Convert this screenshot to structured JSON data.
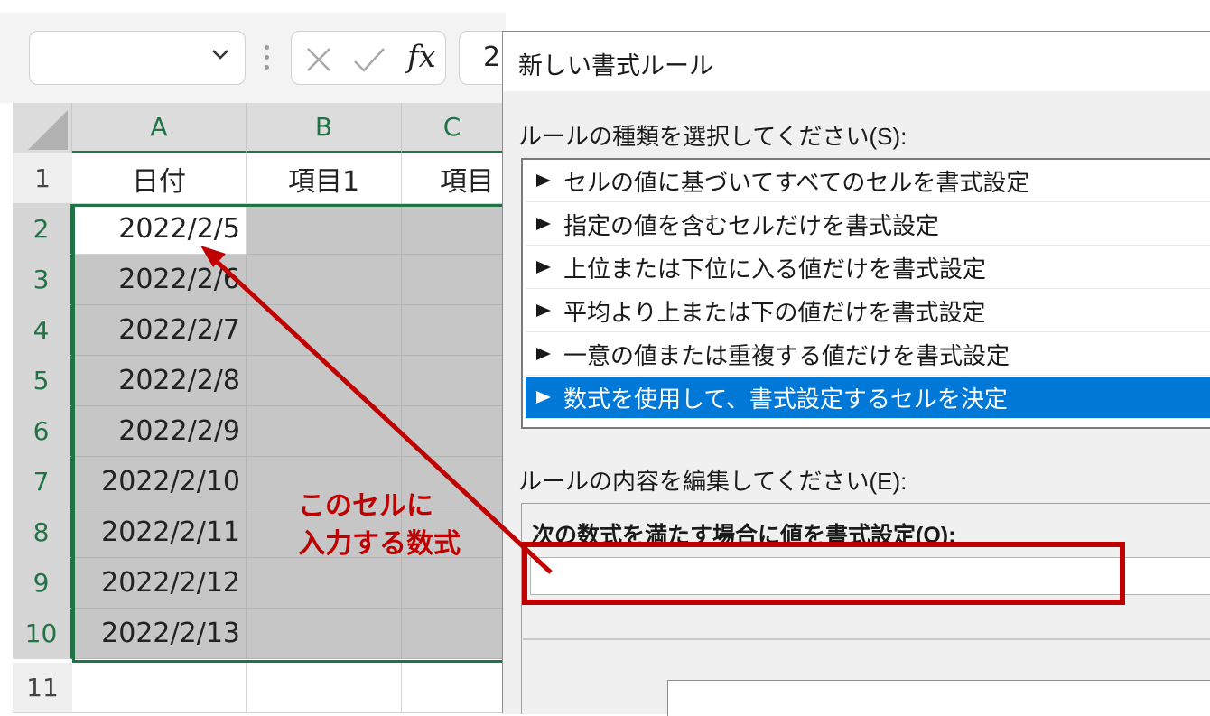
{
  "formula_bar": {
    "fx_label": "fx",
    "content_fragment": "2"
  },
  "sheet": {
    "columns": [
      "A",
      "B",
      "C"
    ],
    "rows": [
      {
        "num": "1",
        "a": "日付",
        "b": "項目1",
        "c": "項目"
      },
      {
        "num": "2",
        "a": "2022/2/5",
        "b": "",
        "c": ""
      },
      {
        "num": "3",
        "a": "2022/2/6",
        "b": "",
        "c": ""
      },
      {
        "num": "4",
        "a": "2022/2/7",
        "b": "",
        "c": ""
      },
      {
        "num": "5",
        "a": "2022/2/8",
        "b": "",
        "c": ""
      },
      {
        "num": "6",
        "a": "2022/2/9",
        "b": "",
        "c": ""
      },
      {
        "num": "7",
        "a": "2022/2/10",
        "b": "",
        "c": ""
      },
      {
        "num": "8",
        "a": "2022/2/11",
        "b": "",
        "c": ""
      },
      {
        "num": "9",
        "a": "2022/2/12",
        "b": "",
        "c": ""
      },
      {
        "num": "10",
        "a": "2022/2/13",
        "b": "",
        "c": ""
      },
      {
        "num": "11",
        "a": "",
        "b": "",
        "c": ""
      }
    ],
    "selection": "A2:C10",
    "active_cell": "A2"
  },
  "dialog": {
    "title": "新しい書式ルール",
    "rule_type_label": "ルールの種類を選択してください(S):",
    "rule_types": [
      "セルの値に基づいてすべてのセルを書式設定",
      "指定の値を含むセルだけを書式設定",
      "上位または下位に入る値だけを書式設定",
      "平均より上または下の値だけを書式設定",
      "一意の値または重複する値だけを書式設定",
      "数式を使用して、書式設定するセルを決定"
    ],
    "selected_rule_index": 5,
    "edit_label": "ルールの内容を編集してください(E):",
    "formula_label": "次の数式を満たす場合に値を書式設定(O):",
    "formula_value": ""
  },
  "annotation": {
    "line1": "このセルに",
    "line2": "入力する数式",
    "color": "#c00000"
  },
  "colors": {
    "excel_green": "#217346",
    "selection_blue": "#0078d7",
    "annotation_red": "#c00000"
  }
}
